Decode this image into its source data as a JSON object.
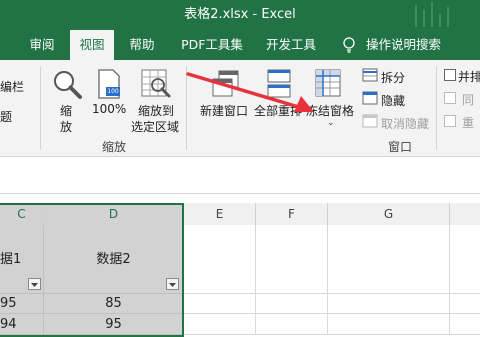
{
  "window": {
    "title": "表格2.xlsx  -  Excel"
  },
  "tabs": [
    {
      "label": "审阅"
    },
    {
      "label": "视图"
    },
    {
      "label": "帮助"
    },
    {
      "label": "PDF工具集"
    },
    {
      "label": "开发工具"
    },
    {
      "label": "操作说明搜索"
    }
  ],
  "ribbon": {
    "left_partial": [
      "编栏",
      "题"
    ],
    "zoom_group": {
      "label": "缩放",
      "zoom_label_1": "缩",
      "zoom_label_2": "放",
      "percent_label": "100%",
      "zoom_sel_1": "缩放到",
      "zoom_sel_2": "选定区域",
      "percent_icon_text": "100"
    },
    "window_group": {
      "label": "窗口",
      "new_window": "新建窗口",
      "arrange_all": "全部重排",
      "freeze_panes": "冻结窗格",
      "split": "拆分",
      "hide": "隐藏",
      "unhide": "取消隐藏",
      "right_1": "并排",
      "right_2": "同",
      "right_3": "重"
    }
  },
  "grid": {
    "columns": [
      "C",
      "D",
      "E",
      "F",
      "G"
    ],
    "header_row": [
      "据1",
      "数据2"
    ],
    "rows": [
      [
        "95",
        "85"
      ],
      [
        "94",
        "95"
      ]
    ]
  },
  "colors": {
    "accent": "#217346",
    "arrow": "#e8323c"
  }
}
